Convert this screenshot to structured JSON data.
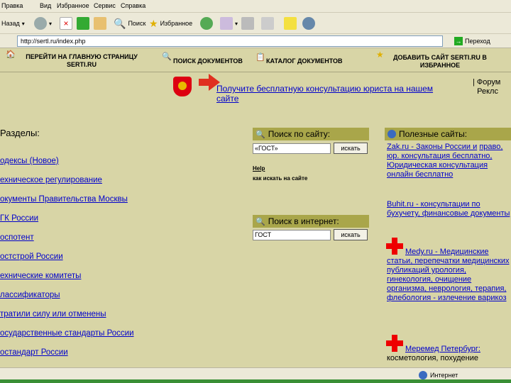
{
  "browser": {
    "menu": [
      "Правка",
      "Вид",
      "Избранное",
      "Сервис",
      "Справка"
    ],
    "toolbar": {
      "back": "Назад",
      "search": "Поиск",
      "favorites": "Избранное"
    },
    "address": {
      "url": "http://sertl.ru/index.php",
      "go": "Переход"
    },
    "status": {
      "zone": "Интернет"
    }
  },
  "sitenav": {
    "home": "ПЕРЕЙТИ НА ГЛАВНУЮ СТРАНИЦУ SERTI.RU",
    "search_docs": "ПОИСК ДОКУМЕНТОВ",
    "catalog": "КАТАЛОГ ДОКУМЕНТОВ",
    "add_site": "ДОБАВИТЬ САЙТ SERTI.RU В ИЗБРАННОЕ"
  },
  "promo": {
    "text": "Получите бесплатную консультацию юриста на нашем сайте"
  },
  "forum": {
    "text": "| Форум\n  Реклс"
  },
  "sections": {
    "title": "Разделы:",
    "items": [
      "одексы (Новое)",
      "ехническое регулирование",
      "окументы Правительства Москвы",
      "ГК России",
      "оспотент",
      "остстрой России",
      "ехнические комитеты",
      "лассификаторы",
      "тратили силу или отменены",
      "осударственные стандарты России",
      "остандарт России"
    ]
  },
  "site_search": {
    "title": "Поиск по сайту:",
    "value": "«ГОСТ»",
    "button": "искать",
    "help_title": "Help",
    "help_text": "как искать на сайте"
  },
  "web_search": {
    "title": "Поиск в интернет:",
    "value": "ГОСТ",
    "button": "искать"
  },
  "useful": {
    "title": "Полезные сайты:",
    "item1": {
      "link": "Zak.ru - Законы России и",
      "rest": "право, юр. консультация бесплатно, Юридическая консультация онлайн бесплатно"
    },
    "item2": {
      "link": "Buhit.ru - консультации по",
      "rest": "бухучету, финансовые документы"
    },
    "item3": {
      "link": "Medy.ru - Медицинские",
      "rest": "статьи, перепечатки медицинских публикаций урология, гинекология, очищение организма, неврология, терапия, флебология - излечение варикоз"
    },
    "item4": {
      "link": "Меремед Петербург:",
      "rest": "косметология, похудение"
    }
  }
}
